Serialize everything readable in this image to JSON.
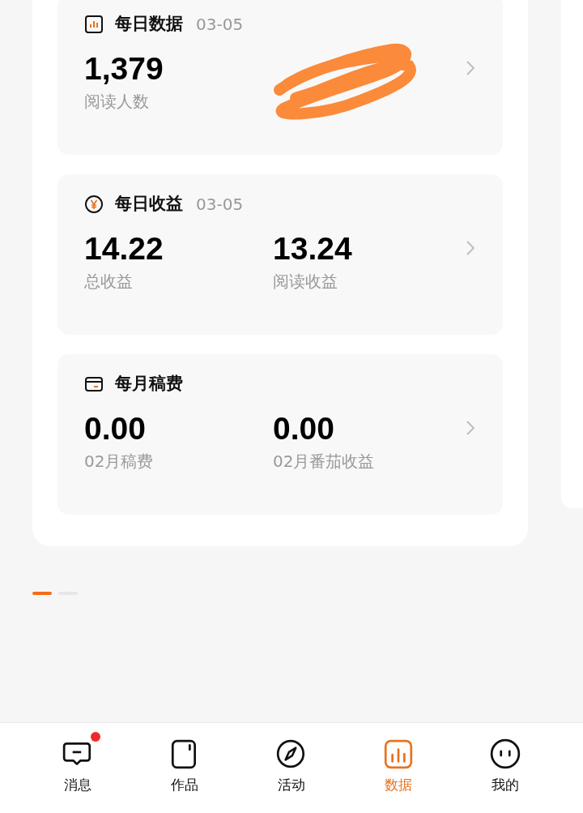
{
  "cards": [
    {
      "title": "每日数据",
      "date": "03-05",
      "metrics": [
        {
          "value": "1,379",
          "label": "阅读人数"
        },
        {
          "redacted": true
        }
      ]
    },
    {
      "title": "每日收益",
      "date": "03-05",
      "metrics": [
        {
          "value": "14.22",
          "label": "总收益"
        },
        {
          "value": "13.24",
          "label": "阅读收益"
        }
      ]
    },
    {
      "title": "每月稿费",
      "metrics": [
        {
          "value": "0.00",
          "label": "02月稿费"
        },
        {
          "value": "0.00",
          "label": "02月番茄收益"
        }
      ]
    }
  ],
  "pager": [
    {
      "selected": true
    },
    {
      "selected": false
    }
  ],
  "nav": [
    {
      "label": "消息",
      "selected": false,
      "badge": true
    },
    {
      "label": "作品",
      "selected": false,
      "badge": false
    },
    {
      "label": "活动",
      "selected": false,
      "badge": false
    },
    {
      "label": "数据",
      "selected": true,
      "badge": false
    },
    {
      "label": "我的",
      "selected": false,
      "badge": false
    }
  ]
}
